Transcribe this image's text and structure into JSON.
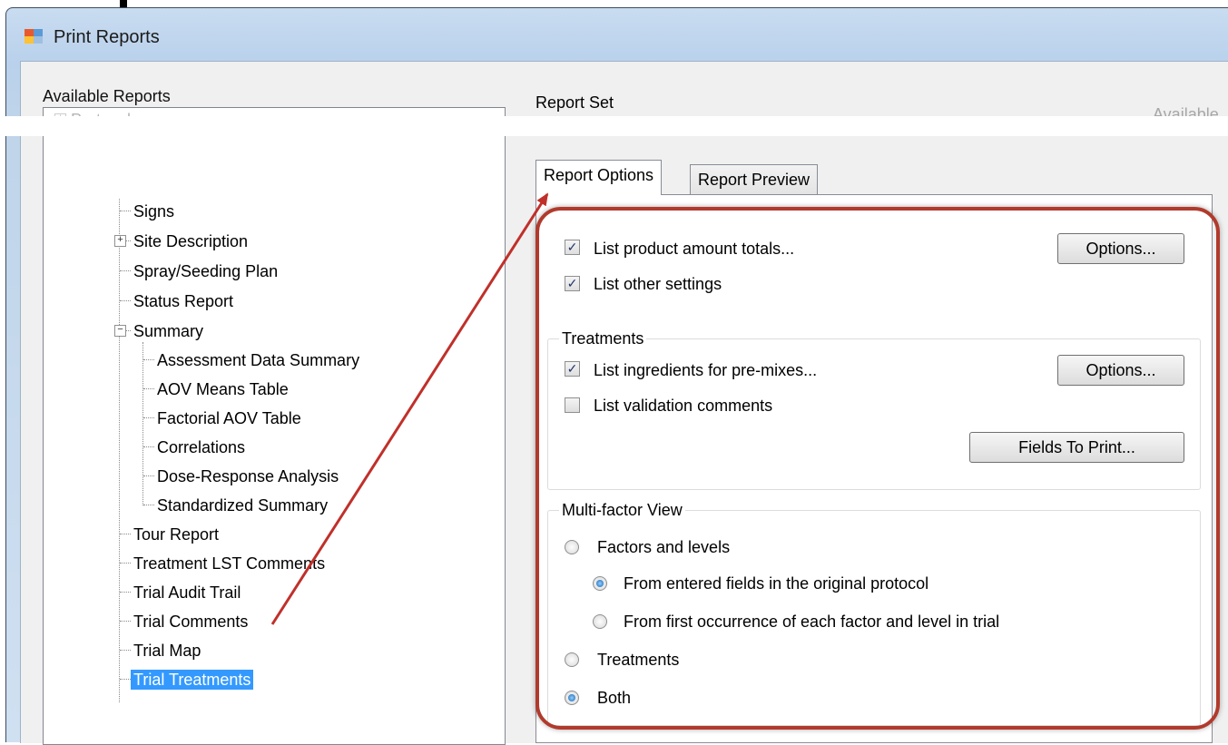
{
  "window": {
    "title": "Print Reports"
  },
  "available_reports": {
    "group_label": "Available Reports",
    "partial_top_item": "Protocol",
    "items": [
      {
        "label": "Signs"
      },
      {
        "label": "Site Description"
      },
      {
        "label": "Spray/Seeding Plan"
      },
      {
        "label": "Status Report"
      },
      {
        "label": "Summary"
      },
      {
        "label": "Assessment Data Summary"
      },
      {
        "label": "AOV Means Table"
      },
      {
        "label": "Factorial AOV Table"
      },
      {
        "label": "Correlations"
      },
      {
        "label": "Dose-Response Analysis"
      },
      {
        "label": "Standardized Summary"
      },
      {
        "label": "Tour Report"
      },
      {
        "label": "Treatment LST Comments"
      },
      {
        "label": "Trial Audit Trail"
      },
      {
        "label": "Trial Comments"
      },
      {
        "label": "Trial Map"
      },
      {
        "label": "Trial Treatments"
      }
    ],
    "selected": "Trial Treatments",
    "expander_expand": "+",
    "expander_collapse": "−"
  },
  "report_set": {
    "label": "Report Set",
    "available_partial": "Available"
  },
  "tabs": [
    {
      "label": "Report Options"
    },
    {
      "label": "Report Preview"
    }
  ],
  "active_tab": "Report Options",
  "options": {
    "list_product_amount_totals": {
      "label": "List product amount totals...",
      "checked": true,
      "button": "Options..."
    },
    "list_other_settings": {
      "label": "List other settings",
      "checked": true
    }
  },
  "treatments": {
    "group_label": "Treatments",
    "list_ingredients": {
      "label": "List ingredients for pre-mixes...",
      "checked": true,
      "button": "Options..."
    },
    "list_validation_comments": {
      "label": "List validation comments",
      "checked": false
    },
    "fields_button": "Fields To Print..."
  },
  "multifactor": {
    "group_label": "Multi-factor View",
    "factors_and_levels": {
      "label": "Factors and levels",
      "selected": false
    },
    "from_entered_fields": {
      "label": "From entered fields in the original protocol",
      "selected": true
    },
    "from_first_occurrence": {
      "label": "From first occurrence of each factor and level in trial",
      "selected": false
    },
    "treatments": {
      "label": "Treatments",
      "selected": false
    },
    "both": {
      "label": "Both",
      "selected": true
    }
  },
  "checkmark_glyph": "✓",
  "colors": {
    "highlight": "#b13a2c",
    "selection": "#3399ff",
    "arrow": "#c0302a"
  }
}
